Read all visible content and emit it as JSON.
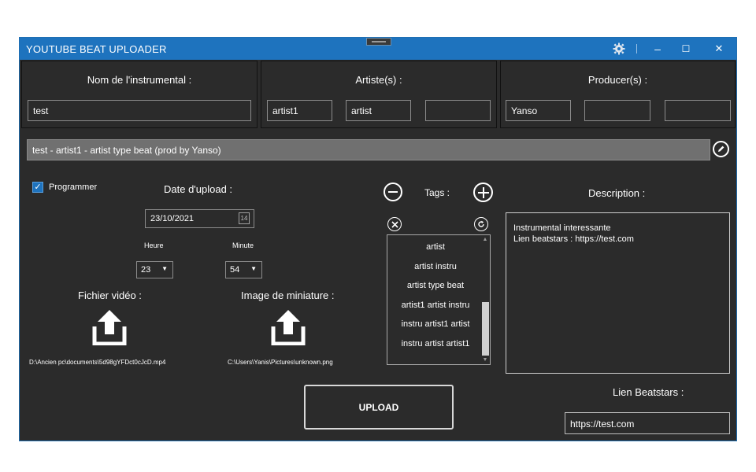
{
  "window": {
    "title": "YOUTUBE BEAT UPLOADER"
  },
  "colors": {
    "titlebar": "#1e73be",
    "background": "#2b2b2b",
    "accent": "#1e73be",
    "scroll_thumb": "#d0d0d0"
  },
  "titlebar_controls": {
    "settings": "gear-icon",
    "minimize": "–",
    "maximize": "☐",
    "close": "✕"
  },
  "instrumental": {
    "label": "Nom de l'instrumental :",
    "value": "test"
  },
  "artists": {
    "label": "Artiste(s) :",
    "values": [
      "artist1",
      "artist",
      ""
    ]
  },
  "producers": {
    "label": "Producer(s) :",
    "values": [
      "Yanso",
      "",
      ""
    ]
  },
  "generated_title": {
    "value": "test - artist1 - artist type beat (prod by Yanso)",
    "edit_icon": "pencil-icon"
  },
  "schedule": {
    "checkbox_label": "Programmer",
    "checked": true,
    "date_label": "Date d'upload :",
    "date_value": "23/10/2021",
    "calendar_icon_text": "14",
    "hour_label": "Heure",
    "hour_value": "23",
    "minute_label": "Minute",
    "minute_value": "54"
  },
  "video": {
    "label": "Fichier vidéo :",
    "path": "D:\\Ancien pc\\documents\\5d98gYFDct0cJcD.mp4"
  },
  "thumbnail": {
    "label": "Image de miniature :",
    "path": "C:\\Users\\Yanis\\Pictures\\unknown.png"
  },
  "tags": {
    "label": "Tags :",
    "items": [
      "artist",
      "artist instru",
      "artist type beat",
      "artist1 artist instru",
      "instru artist1 artist",
      "instru artist artist1"
    ]
  },
  "description": {
    "label": "Description :",
    "lines": [
      "Instrumental interessante",
      "Lien beatstars : https://test.com"
    ]
  },
  "upload": {
    "label": "UPLOAD"
  },
  "beatstars": {
    "label": "Lien Beatstars :",
    "value": "https://test.com"
  }
}
